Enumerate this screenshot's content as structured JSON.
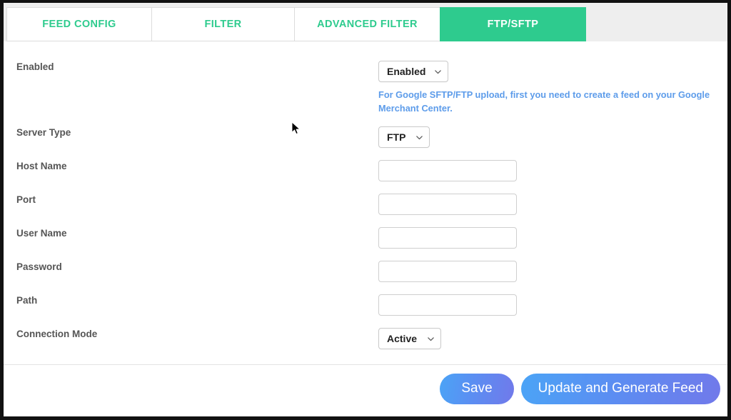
{
  "tabs": [
    {
      "label": "FEED CONFIG",
      "active": false
    },
    {
      "label": "FILTER",
      "active": false
    },
    {
      "label": "ADVANCED FILTER",
      "active": false
    },
    {
      "label": "FTP/SFTP",
      "active": true
    }
  ],
  "form": {
    "enabled": {
      "label": "Enabled",
      "value": "Enabled",
      "hint": "For Google SFTP/FTP upload, first you need to create a feed on your Google Merchant Center."
    },
    "server_type": {
      "label": "Server Type",
      "value": "FTP"
    },
    "host_name": {
      "label": "Host Name",
      "value": "",
      "placeholder": ""
    },
    "port": {
      "label": "Port",
      "value": "",
      "placeholder": ""
    },
    "user_name": {
      "label": "User Name",
      "value": "",
      "placeholder": ""
    },
    "password": {
      "label": "Password",
      "value": "",
      "placeholder": ""
    },
    "path": {
      "label": "Path",
      "value": "",
      "placeholder": ""
    },
    "connection_mode": {
      "label": "Connection Mode",
      "value": "Active"
    }
  },
  "footer": {
    "save_label": "Save",
    "update_label": "Update and Generate Feed"
  },
  "colors": {
    "tab_text": "#2ecb8e",
    "tab_active_bg": "#2ecb8e",
    "hint_link": "#5d9cea",
    "button_gradient_start": "#4ba4f6",
    "button_gradient_end": "#7179ea",
    "label_text": "#555555",
    "frame": "#111111"
  },
  "icons": {
    "chevron": "chevron-down-icon",
    "cursor": "mouse-pointer-icon"
  }
}
